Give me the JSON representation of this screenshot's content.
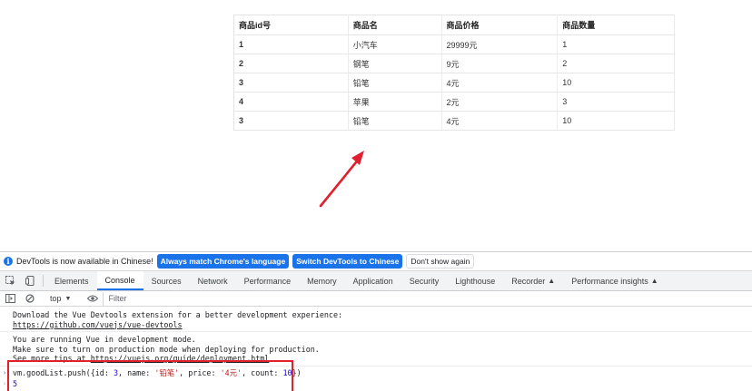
{
  "table": {
    "headers": [
      "商品id号",
      "商品名",
      "商品价格",
      "商品数量"
    ],
    "rows": [
      {
        "id": "1",
        "name": "小汽车",
        "price": "29999元",
        "count": "1"
      },
      {
        "id": "2",
        "name": "钢笔",
        "price": "9元",
        "count": "2"
      },
      {
        "id": "3",
        "name": "铅笔",
        "price": "4元",
        "count": "10"
      },
      {
        "id": "4",
        "name": "苹果",
        "price": "2元",
        "count": "3"
      },
      {
        "id": "3",
        "name": "铅笔",
        "price": "4元",
        "count": "10"
      }
    ]
  },
  "annotation": {
    "color": "#e0202c"
  },
  "devtools": {
    "infobar": {
      "icon": "info-icon",
      "text": "DevTools is now available in Chinese!",
      "match_button": "Always match Chrome's language",
      "switch_button": "Switch DevTools to Chinese",
      "dismiss_button": "Don't show again"
    },
    "tabs": [
      "Elements",
      "Console",
      "Sources",
      "Network",
      "Performance",
      "Memory",
      "Application",
      "Security",
      "Lighthouse",
      "Recorder",
      "Performance insights"
    ],
    "active_tab": "Console",
    "toolbar": {
      "context": "top",
      "filter_placeholder": "Filter"
    },
    "messages": [
      {
        "text": "Download the Vue Devtools extension for a better development experience:",
        "link": "https://github.com/vuejs/vue-devtools"
      },
      {
        "line1": "You are running Vue in development mode.",
        "line2": "Make sure to turn on production mode when deploying for production.",
        "line3_prefix": "See more tips at ",
        "link": "https://vuejs.org/guide/deployment.html"
      }
    ],
    "input": {
      "prefix": "vm.goodList.push({id: ",
      "id_val": "3",
      "name_key": ", name: ",
      "name_val": "'铅笔'",
      "price_key": ", price: ",
      "price_val": "'4元'",
      "count_key": ", count: ",
      "count_val": "10",
      "suffix": "})"
    },
    "result": "5"
  },
  "colors": {
    "accent": "#1a73e8",
    "highlight": "#e0202c"
  }
}
